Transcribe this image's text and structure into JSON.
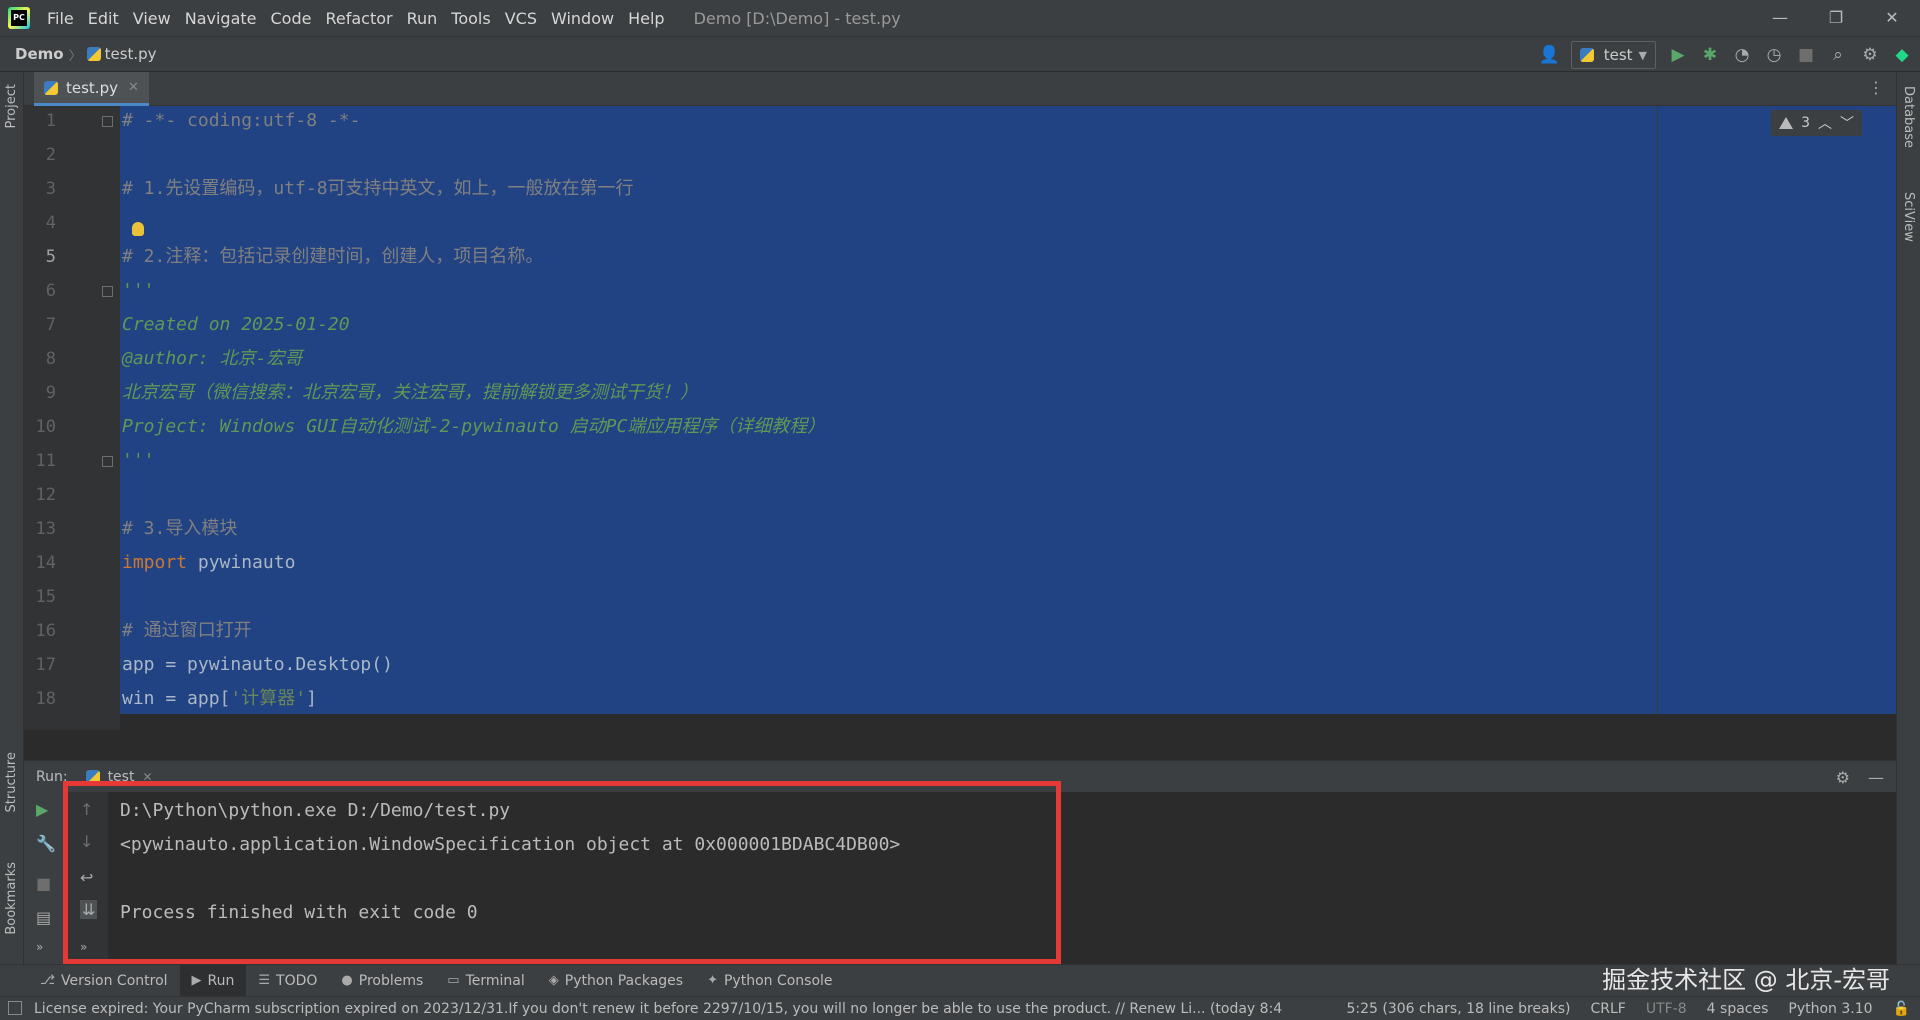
{
  "menu": [
    "File",
    "Edit",
    "View",
    "Navigate",
    "Code",
    "Refactor",
    "Run",
    "Tools",
    "VCS",
    "Window",
    "Help"
  ],
  "window_title": "Demo [D:\\Demo] - test.py",
  "window_controls": {
    "minimize": "—",
    "restore": "❐",
    "close": "✕"
  },
  "breadcrumb": {
    "project": "Demo",
    "file": "test.py"
  },
  "run_config": {
    "name": "test"
  },
  "icons": {
    "user": "user-icon",
    "run": "run-icon",
    "debug": "debug-icon",
    "coverage": "coverage-icon",
    "profile": "profile-icon",
    "stop": "stop-icon",
    "search": "search-icon",
    "settings": "gear-icon",
    "logo": "jetbrains-logo-icon"
  },
  "left_strip": {
    "project": "Project",
    "structure": "Structure",
    "bookmarks": "Bookmarks"
  },
  "right_strip": {
    "database": "Database",
    "sciview": "SciView"
  },
  "editor_tab": {
    "label": "test.py",
    "close": "✕"
  },
  "inspections": {
    "count": "3"
  },
  "code_lines": [
    {
      "n": "1",
      "text": "# -*- coding:utf-8 -*-",
      "style": "comment"
    },
    {
      "n": "2",
      "text": "",
      "style": "plain"
    },
    {
      "n": "3",
      "text": "# 1.先设置编码，utf-8可支持中英文，如上，一般放在第一行",
      "style": "comment"
    },
    {
      "n": "4",
      "text": "",
      "style": "plain"
    },
    {
      "n": "5",
      "text": "# 2.注释：包括记录创建时间，创建人，项目名称。",
      "style": "comment"
    },
    {
      "n": "6",
      "text": "'''",
      "style": "doc"
    },
    {
      "n": "7",
      "text": "Created on 2025-01-20",
      "style": "doc"
    },
    {
      "n": "8",
      "text": "@author: 北京-宏哥",
      "style": "doc"
    },
    {
      "n": "9",
      "text": "北京宏哥（微信搜索：北京宏哥，关注宏哥，提前解锁更多测试干货！）",
      "style": "doc"
    },
    {
      "n": "10",
      "text": "Project: Windows GUI自动化测试-2-pywinauto 启动PC端应用程序（详细教程）",
      "style": "doc"
    },
    {
      "n": "11",
      "text": "'''",
      "style": "doc"
    },
    {
      "n": "12",
      "text": "",
      "style": "plain"
    },
    {
      "n": "13",
      "text": "# 3.导入模块",
      "style": "comment"
    },
    {
      "n": "14",
      "kw": "import",
      "text": " pywinauto",
      "style": "import"
    },
    {
      "n": "15",
      "text": "",
      "style": "plain"
    },
    {
      "n": "16",
      "text": "# 通过窗口打开",
      "style": "comment"
    },
    {
      "n": "17",
      "text": "app = pywinauto.Desktop()",
      "style": "plain"
    },
    {
      "n": "18",
      "pre": "win = app[",
      "str": "'计算器'",
      "post": "]",
      "style": "index"
    }
  ],
  "current_line": "5",
  "run_window": {
    "label": "Run:",
    "tab": "test",
    "tab_close": "✕"
  },
  "console": [
    "D:\\Python\\python.exe D:/Demo/test.py",
    "<pywinauto.application.WindowSpecification object at 0x000001BDABC4DB00>",
    "",
    "Process finished with exit code 0"
  ],
  "bottom_tools": [
    {
      "label": "Version Control",
      "icon": "version-control-icon",
      "glyph": "⎇"
    },
    {
      "label": "Run",
      "icon": "run-tool-icon",
      "glyph": "▶"
    },
    {
      "label": "TODO",
      "icon": "todo-icon",
      "glyph": "☰"
    },
    {
      "label": "Problems",
      "icon": "problems-icon",
      "glyph": "●"
    },
    {
      "label": "Terminal",
      "icon": "terminal-icon",
      "glyph": "▭"
    },
    {
      "label": "Python Packages",
      "icon": "packages-icon",
      "glyph": "◈"
    },
    {
      "label": "Python Console",
      "icon": "python-console-icon",
      "glyph": "✦"
    }
  ],
  "watermark": "掘金技术社区 @ 北京-宏哥",
  "status": {
    "message": "License expired: Your PyCharm subscription expired on 2023/12/31.If you don't renew it before 2297/10/15, you will no longer be able to use the product. // Renew Li... (today 8:4",
    "position": "5:25 (306 chars, 18 line breaks)",
    "line_sep": "CRLF",
    "encoding": "UTF-8",
    "indent": "4 spaces",
    "interpreter": "Python 3.10"
  },
  "colors": {
    "accent": "#4a88c7",
    "selection": "#214283",
    "highlight_box": "#e53935"
  }
}
